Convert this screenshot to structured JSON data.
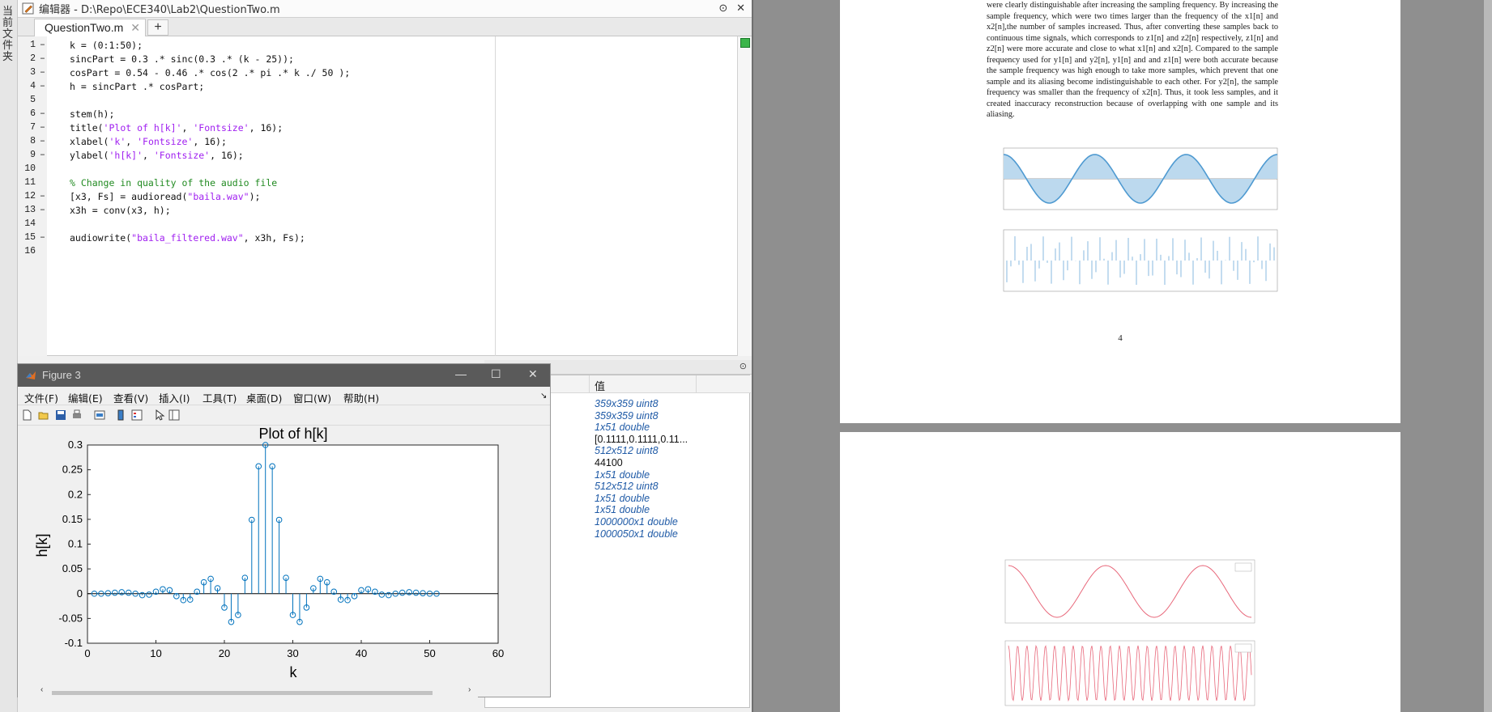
{
  "editor": {
    "side_tab_label": "当前文件夹",
    "title": "编辑器 - D:\\Repo\\ECE340\\Lab2\\QuestionTwo.m",
    "tab_label": "QuestionTwo.m",
    "tab_close": "✕",
    "add_tab": "+",
    "lines": [
      {
        "n": "1",
        "d": "–",
        "code": "k = (0:1:50);"
      },
      {
        "n": "2",
        "d": "–",
        "code": "sincPart = 0.3 .* sinc(0.3 .* (k - 25));"
      },
      {
        "n": "3",
        "d": "–",
        "code": "cosPart = 0.54 - 0.46 .* cos(2 .* pi .* k ./ 50 );"
      },
      {
        "n": "4",
        "d": "–",
        "code": "h = sincPart .* cosPart;"
      },
      {
        "n": "5",
        "d": "",
        "code": ""
      },
      {
        "n": "6",
        "d": "–",
        "code": "stem(h);"
      },
      {
        "n": "7",
        "d": "–",
        "code_a": "title(",
        "str_a": "'Plot of h[k]'",
        "code_b": ", ",
        "str_b": "'Fontsize'",
        "code_c": ", 16);"
      },
      {
        "n": "8",
        "d": "–",
        "code_a": "xlabel(",
        "str_a": "'k'",
        "code_b": ", ",
        "str_b": "'Fontsize'",
        "code_c": ", 16);"
      },
      {
        "n": "9",
        "d": "–",
        "code_a": "ylabel(",
        "str_a": "'h[k]'",
        "code_b": ", ",
        "str_b": "'Fontsize'",
        "code_c": ", 16);"
      },
      {
        "n": "10",
        "d": "",
        "code": ""
      },
      {
        "n": "11",
        "d": "",
        "comment": "% Change in quality of the audio file"
      },
      {
        "n": "12",
        "d": "–",
        "code_a": "[x3, Fs] = audioread(",
        "str_a": "\"baila.wav\"",
        "code_b": ");",
        "str_b": "",
        "code_c": ""
      },
      {
        "n": "13",
        "d": "–",
        "code": "x3h = conv(x3, h);"
      },
      {
        "n": "14",
        "d": "",
        "code": ""
      },
      {
        "n": "15",
        "d": "–",
        "code_a": "audiowrite(",
        "str_a": "\"baila_filtered.wav\"",
        "code_b": ", x3h, Fs);",
        "str_b": "",
        "code_c": ""
      },
      {
        "n": "16",
        "d": "",
        "code": ""
      }
    ]
  },
  "workspace": {
    "value_header": "值",
    "values": [
      {
        "text": "359x359 uint8",
        "italic": true
      },
      {
        "text": "359x359 uint8",
        "italic": true
      },
      {
        "text": "1x51 double",
        "italic": true
      },
      {
        "text": "[0.1111,0.1111,0.11...",
        "italic": false
      },
      {
        "text": "512x512 uint8",
        "italic": true
      },
      {
        "text": "44100",
        "italic": false
      },
      {
        "text": "1x51 double",
        "italic": true
      },
      {
        "text": "512x512 uint8",
        "italic": true
      },
      {
        "text": "1x51 double",
        "italic": true
      },
      {
        "text": "1x51 double",
        "italic": true
      },
      {
        "text": "1000000x1 double",
        "italic": true
      },
      {
        "text": "1000050x1 double",
        "italic": true
      }
    ]
  },
  "figure": {
    "title": "Figure 3",
    "minimize": "—",
    "maximize": "☐",
    "close": "✕",
    "menu": [
      "文件(F)",
      "编辑(E)",
      "查看(V)",
      "插入(I)",
      "工具(T)",
      "桌面(D)",
      "窗口(W)",
      "帮助(H)"
    ],
    "tool_icons": [
      "new-figure-icon",
      "open-icon",
      "save-icon",
      "print-icon",
      "link-icon",
      "colorbar-icon",
      "legend-icon",
      "pointer-icon",
      "property-editor-icon"
    ]
  },
  "chart_data": {
    "type": "stem",
    "title": "Plot of h[k]",
    "xlabel": "k",
    "ylabel": "h[k]",
    "xlim": [
      0,
      60
    ],
    "ylim": [
      -0.1,
      0.3
    ],
    "xticks": [
      "0",
      "10",
      "20",
      "30",
      "40",
      "50",
      "60"
    ],
    "yticks": [
      "-0.1",
      "-0.05",
      "0",
      "0.05",
      "0.1",
      "0.15",
      "0.2",
      "0.25",
      "0.3"
    ],
    "x": [
      1,
      2,
      3,
      4,
      5,
      6,
      7,
      8,
      9,
      10,
      11,
      12,
      13,
      14,
      15,
      16,
      17,
      18,
      19,
      20,
      21,
      22,
      23,
      24,
      25,
      26,
      27,
      28,
      29,
      30,
      31,
      32,
      33,
      34,
      35,
      36,
      37,
      38,
      39,
      40,
      41,
      42,
      43,
      44,
      45,
      46,
      47,
      48,
      49,
      50,
      51
    ],
    "values": [
      0,
      0,
      0.001,
      0.002,
      0.003,
      0.002,
      0,
      -0.003,
      -0.002,
      0.004,
      0.009,
      0.007,
      -0.005,
      -0.013,
      -0.012,
      0.004,
      0.023,
      0.03,
      0.011,
      -0.028,
      -0.057,
      -0.043,
      0.032,
      0.149,
      0.257,
      0.3,
      0.257,
      0.149,
      0.032,
      -0.043,
      -0.057,
      -0.028,
      0.011,
      0.03,
      0.023,
      0.004,
      -0.012,
      -0.013,
      -0.005,
      0.007,
      0.009,
      0.004,
      -0.002,
      -0.003,
      0,
      0.002,
      0.003,
      0.002,
      0.001,
      0,
      0
    ],
    "color": "#0072bd"
  },
  "viewer": {
    "paragraph": "were clearly distinguishable after increasing the sampling frequency. By increasing the sample frequency, which were two times larger than the frequency of the x1[n] and x2[n],the number of samples increased. Thus, after converting these samples back to continuous time signals, which corresponds to z1[n] and z2[n] respectively, z1[n] and z2[n] were more accurate and close to what x1[n] and x2[n]. Compared to the sample frequency used for y1[n] and y2[n], y1[n] and and z1[n] were both accurate because the sample frequency was high enough to take more samples, which prevent that one sample and its aliasing become indistinguishable to each other. For y2[n], the sample frequency was smaller than the frequency of x2[n]. Thus, it took less samples, and it created inaccuracy reconstruction because of overlapping with one sample and its aliasing.",
    "page_number": "4"
  }
}
